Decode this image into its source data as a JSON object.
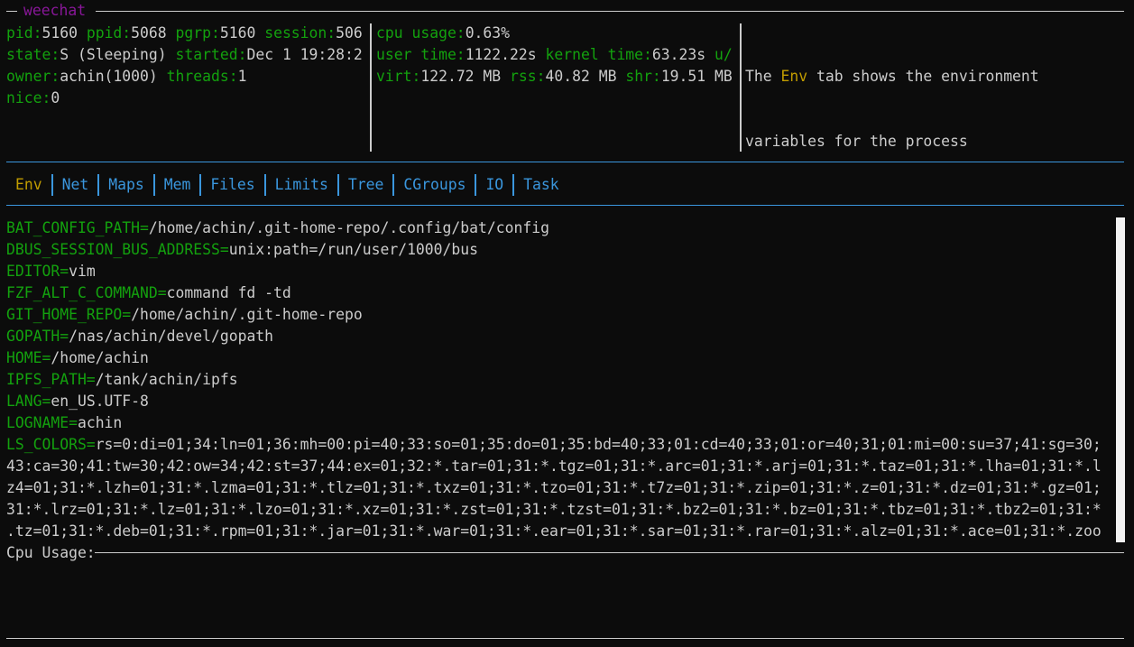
{
  "window": {
    "title": "weechat"
  },
  "process_info": {
    "col1": [
      [
        {
          "k": "pid:",
          "v": "5160 "
        },
        {
          "k": "ppid:",
          "v": "5068 "
        },
        {
          "k": "pgrp:",
          "v": "5160 "
        },
        {
          "k": "session:",
          "v": "506"
        }
      ],
      [
        {
          "k": "state:",
          "v": "S (Sleeping) "
        },
        {
          "k": "started:",
          "v": "Dec 1 19:28:2"
        }
      ],
      [
        {
          "k": "owner:",
          "v": "achin(1000) "
        },
        {
          "k": "threads:",
          "v": "1"
        }
      ],
      [
        {
          "k": "nice:",
          "v": "0"
        }
      ]
    ],
    "col2": [
      [
        {
          "k": "cpu usage:",
          "v": "0.63%"
        }
      ],
      [
        {
          "k": "user time:",
          "v": "1122.22s "
        },
        {
          "k": "kernel time:",
          "v": "63.23s "
        },
        {
          "k": "u/",
          "v": ""
        }
      ],
      [
        {
          "k": "virt:",
          "v": "122.72 MB "
        },
        {
          "k": "rss:",
          "v": "40.82 MB "
        },
        {
          "k": "shr:",
          "v": "19.51 MB"
        }
      ]
    ]
  },
  "help": {
    "prefix": "The ",
    "highlight": "Env",
    "suffix": " tab shows the environment",
    "line2": "variables for the process"
  },
  "tabs": [
    {
      "label": "Env",
      "active": true
    },
    {
      "label": "Net",
      "active": false
    },
    {
      "label": "Maps",
      "active": false
    },
    {
      "label": "Mem",
      "active": false
    },
    {
      "label": "Files",
      "active": false
    },
    {
      "label": "Limits",
      "active": false
    },
    {
      "label": "Tree",
      "active": false
    },
    {
      "label": "CGroups",
      "active": false
    },
    {
      "label": "IO",
      "active": false
    },
    {
      "label": "Task",
      "active": false
    }
  ],
  "env": [
    {
      "key": "BAT_CONFIG_PATH=",
      "value": "/home/achin/.git-home-repo/.config/bat/config"
    },
    {
      "key": "DBUS_SESSION_BUS_ADDRESS=",
      "value": "unix:path=/run/user/1000/bus"
    },
    {
      "key": "EDITOR=",
      "value": "vim"
    },
    {
      "key": "FZF_ALT_C_COMMAND=",
      "value": "command fd -td"
    },
    {
      "key": "GIT_HOME_REPO=",
      "value": "/home/achin/.git-home-repo"
    },
    {
      "key": "GOPATH=",
      "value": "/nas/achin/devel/gopath"
    },
    {
      "key": "HOME=",
      "value": "/home/achin"
    },
    {
      "key": "IPFS_PATH=",
      "value": "/tank/achin/ipfs"
    },
    {
      "key": "LANG=",
      "value": "en_US.UTF-8"
    },
    {
      "key": "LOGNAME=",
      "value": "achin"
    },
    {
      "key": "LS_COLORS=",
      "value": "rs=0:di=01;34:ln=01;36:mh=00:pi=40;33:so=01;35:do=01;35:bd=40;33;01:cd=40;33;01:or=40;31;01:mi=00:su=37;41:sg=30;"
    }
  ],
  "env_wrapped": [
    "43:ca=30;41:tw=30;42:ow=34;42:st=37;44:ex=01;32:*.tar=01;31:*.tgz=01;31:*.arc=01;31:*.arj=01;31:*.taz=01;31:*.lha=01;31:*.l",
    "z4=01;31:*.lzh=01;31:*.lzma=01;31:*.tlz=01;31:*.txz=01;31:*.tzo=01;31:*.t7z=01;31:*.zip=01;31:*.z=01;31:*.dz=01;31:*.gz=01;",
    "31:*.lrz=01;31:*.lz=01;31:*.lzo=01;31:*.xz=01;31:*.zst=01;31:*.tzst=01;31:*.bz2=01;31:*.bz=01;31:*.tbz=01;31:*.tbz2=01;31:*",
    ".tz=01;31:*.deb=01;31:*.rpm=01;31:*.jar=01;31:*.war=01;31:*.ear=01;31:*.sar=01;31:*.rar=01;31:*.alz=01;31:*.ace=01;31:*.zoo"
  ],
  "cpu_graph": {
    "label": "Cpu Usage:"
  },
  "colors": {
    "label_green": "#13a10e",
    "tab_blue": "#3a96dd",
    "active_yellow": "#c19c00",
    "title_purple": "#881798",
    "text": "#cccccc",
    "background": "#0c0c0c"
  }
}
